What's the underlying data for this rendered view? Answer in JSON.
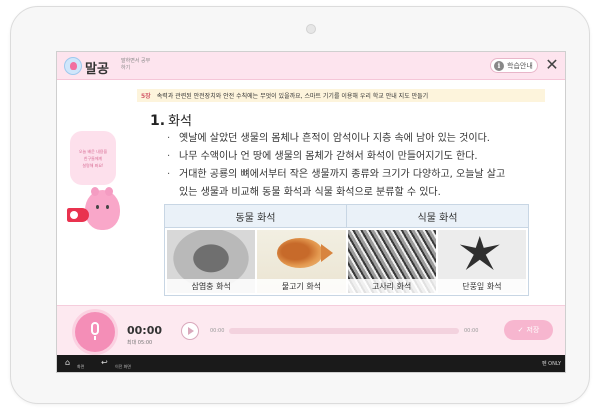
{
  "app": {
    "title": "말공",
    "subtitle": "말하면서 공부하기",
    "guide_label": "학습안내",
    "close_label": "✕"
  },
  "question": {
    "chapter": "5장",
    "text": "속력과 관련된 안전장치와 안전 수칙에는 무엇이 있을까요, 스마트 기기를 이용해 우리 학교 안내 지도 만들기"
  },
  "side": {
    "bubble_lines": [
      "오늘 배운 내용을",
      "친구들에게",
      "설명해 봐요!"
    ]
  },
  "content": {
    "number": "1.",
    "heading": "화석",
    "bullets": [
      "옛날에 살았던 생물의 몸체나 흔적이 암석이나 지층 속에 남아 있는 것이다.",
      "나무 수액이나 언 땅에 생물의 몸체가 갇혀서 화석이 만들어지기도 한다.",
      "거대한 공룡의 뼈에서부터 작은 생물까지 종류와 크기가 다양하고, 오늘날 살고"
    ],
    "bullet_continuation": "있는 생물과 비교해 동물 화석과 식물 화석으로 분류할 수 있다.",
    "table": {
      "headers": [
        "동물 화석",
        "식물 화석"
      ],
      "captions": [
        "삼엽충 화석",
        "물고기 화석",
        "고사리 화석",
        "단풍잎 화석"
      ]
    }
  },
  "recorder": {
    "time": "00:00",
    "max_time": "최대 05:00",
    "play_start": "00:00",
    "play_end": "00:00",
    "progress": 0,
    "save_label": "저장"
  },
  "navbar": {
    "home_label": "화면",
    "back_label": "이전 화면",
    "right_label": "펜 ONLY"
  }
}
